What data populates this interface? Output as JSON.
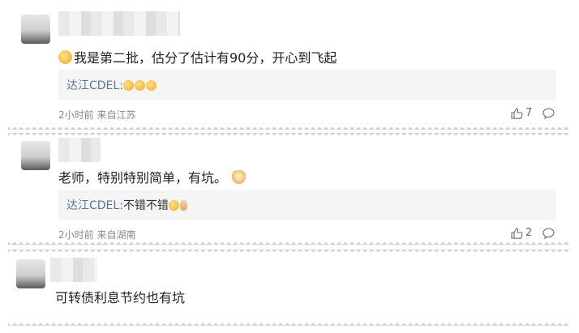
{
  "comments": [
    {
      "text": "我是第二批，估分了估计有90分，开心到飞起",
      "reply": {
        "author": "达江CDEL:",
        "body": ""
      },
      "time": "2小时前",
      "location": "来自江苏",
      "likes": "7"
    },
    {
      "text": "老师，特别特别简单，有坑。",
      "reply": {
        "author": "达江CDEL:",
        "body": "不错不错"
      },
      "time": "2小时前",
      "location": "来自湖南",
      "likes": "2"
    },
    {
      "text": "可转债利息节约也有坑"
    }
  ],
  "icons": {
    "like": "thumbs-up-icon",
    "reply": "speech-bubble-icon",
    "emoji": "smiley-emoji-icon"
  },
  "colors": {
    "reply_author": "#58769e",
    "meta": "#8a8a8a",
    "reply_bg": "#f5f5f5"
  }
}
